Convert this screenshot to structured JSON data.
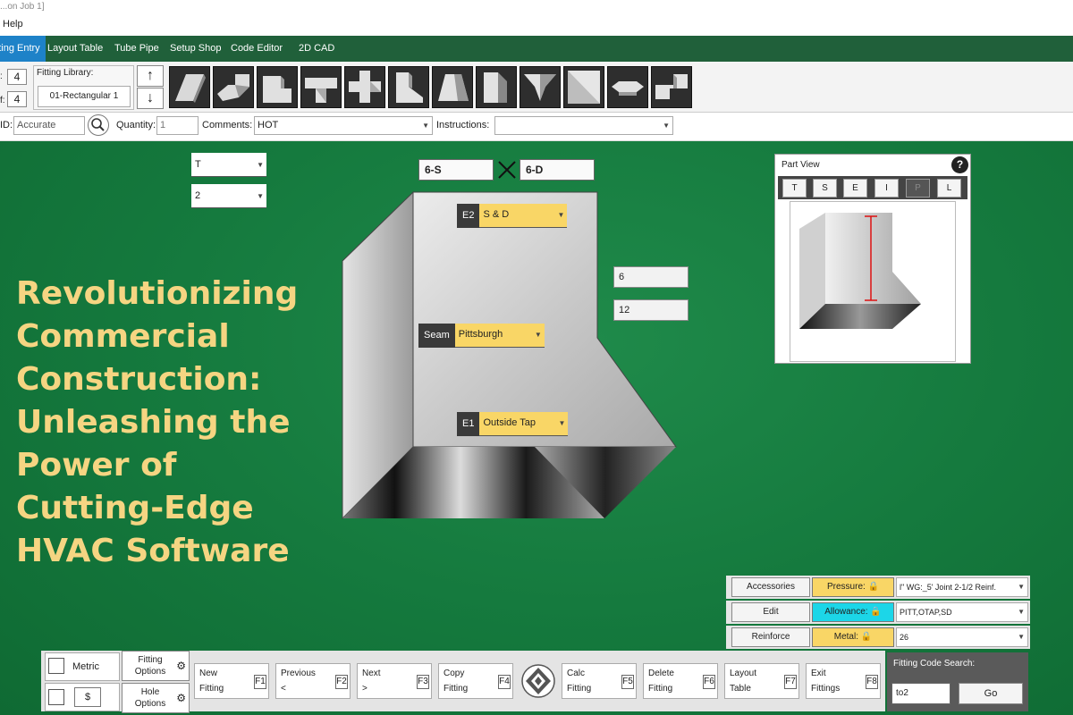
{
  "window": {
    "title": "...on Job 1]"
  },
  "menu": {
    "help": "Help"
  },
  "ribbon": {
    "tabs": [
      "Fitting Entry",
      "Layout Table",
      "Tube Pipe",
      "Setup Shop",
      "Code Editor",
      "2D CAD"
    ],
    "active_tab": "Fitting Entry",
    "accent": "#1e82c8"
  },
  "toolbar": {
    "field_a_label": ":",
    "field_a_value": "4",
    "field_b_label": "f:",
    "field_b_value": "4",
    "fitting_library_label": "Fitting Library:",
    "fitting_library_value": "01-Rectangular 1",
    "up_arrow": "↑",
    "down_arrow": "↓",
    "fitting_icons": [
      "straight-duct-icon",
      "offset-icon",
      "elbow-icon",
      "tee-icon",
      "cross-icon",
      "wye-icon",
      "transition-icon",
      "end-cap-icon",
      "reducer-icon",
      "square-panel-icon",
      "saddle-icon",
      "step-offset-icon"
    ]
  },
  "fields": {
    "id_label": "ID:",
    "id_value": "Accurate",
    "quantity_label": "Quantity:",
    "quantity_value": "1",
    "comments_label": "Comments:",
    "comments_value": "HOT",
    "instructions_label": "Instructions:",
    "instructions_value": ""
  },
  "canvas": {
    "dropdown_1": "T",
    "dropdown_2": "2",
    "dim_left": "6-S",
    "dim_right": "6-D",
    "value_1": "6",
    "value_2": "12",
    "tags": {
      "e2_key": "E2",
      "e2_value": "S & D",
      "seam_key": "Seam",
      "seam_value": "Pittsburgh",
      "e1_key": "E1",
      "e1_value": "Outside Tap"
    }
  },
  "hero": {
    "lines": [
      "Revolutionizing",
      "Commercial",
      "Construction:",
      "Unleashing the",
      "Power of",
      "Cutting-Edge",
      "HVAC Software"
    ],
    "color": "#f5d582"
  },
  "part_view": {
    "title": "Part View",
    "help": "?",
    "tabs": [
      "T",
      "S",
      "E",
      "I",
      "P",
      "L"
    ],
    "active_tab": "P"
  },
  "right_panel": {
    "accessories": "Accessories",
    "edit": "Edit",
    "reinforce": "Reinforce",
    "pressure_label": "Pressure:",
    "pressure_value": "l\" WG:_5' Joint 2-1/2  Reinf.",
    "allowance_label": "Allowance:",
    "allowance_value": "PITT,OTAP,SD",
    "metal_label": "Metal:",
    "metal_value": "26",
    "pressure_color": "#f9d666",
    "allowance_color": "#1cd6e8"
  },
  "bottom": {
    "metric_label": "Metric",
    "currency_label": "$",
    "fitting_options": "Fitting Options",
    "hole_options": "Hole Options",
    "buttons": [
      {
        "l1": "New",
        "l2": "Fitting",
        "key": "F1"
      },
      {
        "l1": "Previous",
        "l2": "<",
        "key": "F2"
      },
      {
        "l1": "Next",
        "l2": ">",
        "key": "F3"
      },
      {
        "l1": "Copy",
        "l2": "Fitting",
        "key": "F4"
      },
      {
        "l1": "Calc",
        "l2": "Fitting",
        "key": "F5"
      },
      {
        "l1": "Delete",
        "l2": "Fitting",
        "key": "F6"
      },
      {
        "l1": "Layout",
        "l2": "Table",
        "key": "F7"
      },
      {
        "l1": "Exit",
        "l2": "Fittings",
        "key": "F8"
      }
    ],
    "search_label": "Fitting Code Search:",
    "search_value": "to2",
    "go": "Go"
  }
}
